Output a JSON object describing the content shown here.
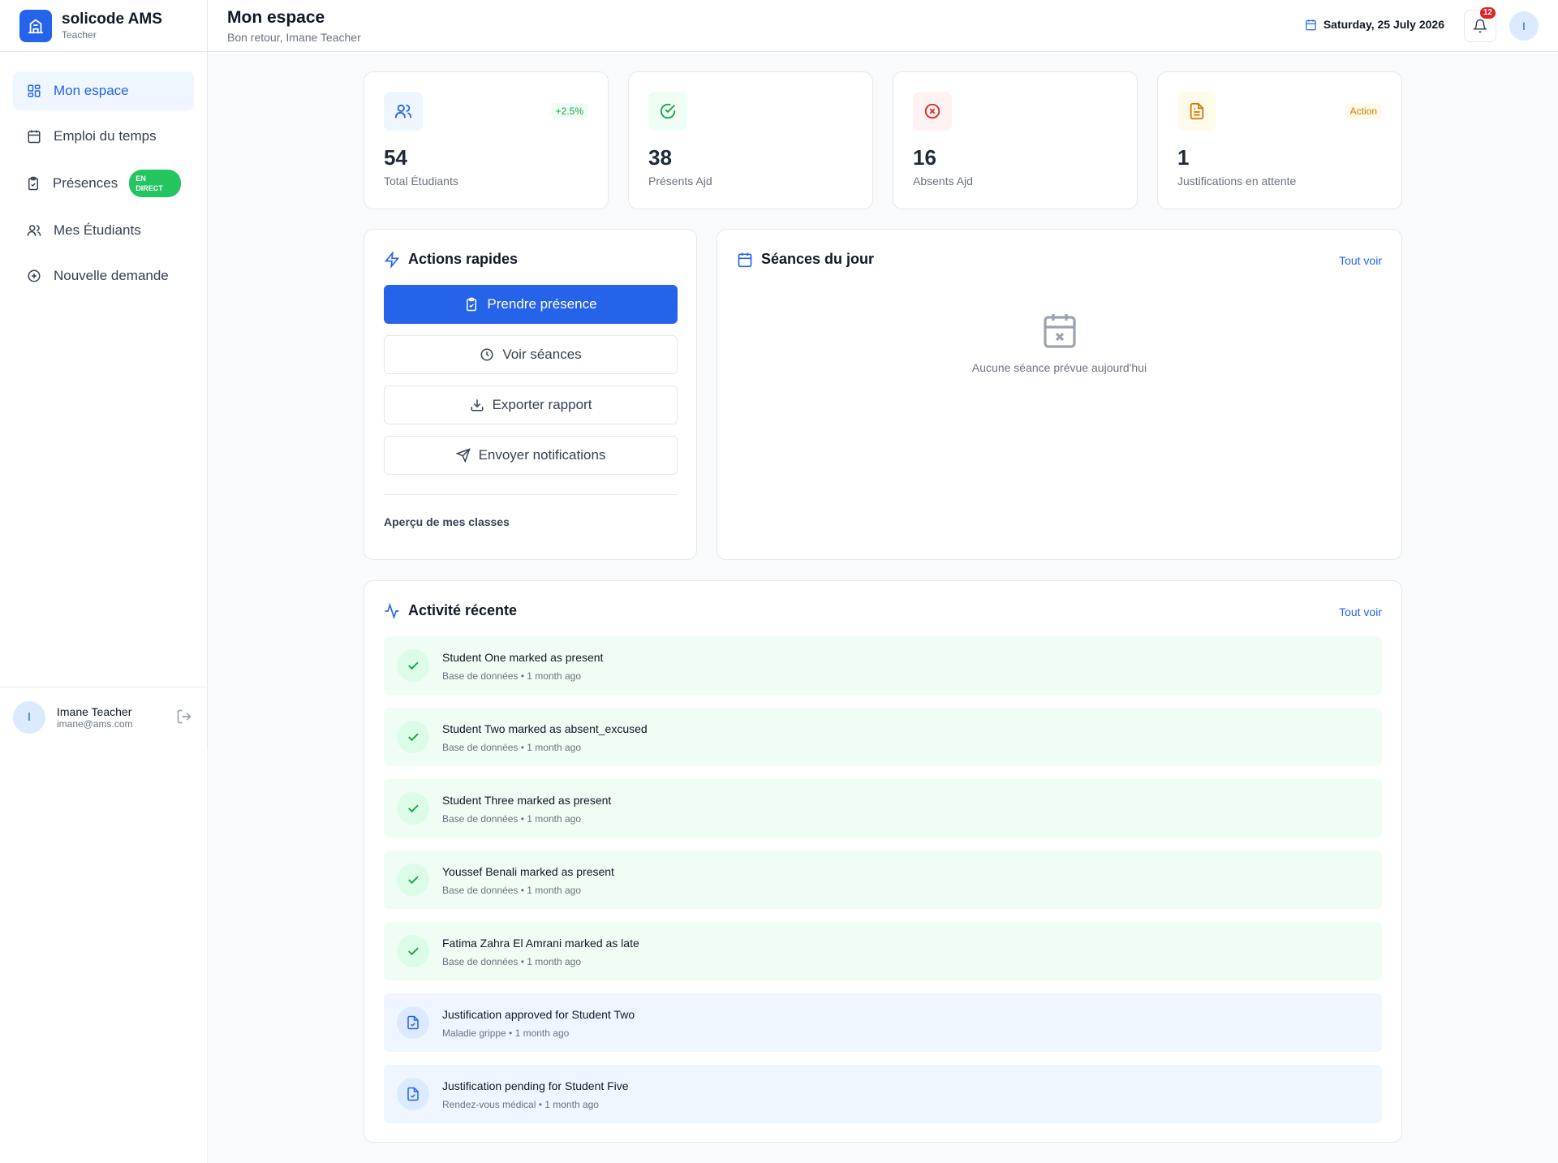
{
  "app": {
    "name": "solicode AMS",
    "role": "Teacher",
    "brand_color": "#2563eb"
  },
  "sidebar": {
    "items": [
      {
        "label": "Mon espace",
        "icon": "dashboard-grid-icon",
        "active": true
      },
      {
        "label": "Emploi du temps",
        "icon": "calendar-icon"
      },
      {
        "label": "Présences",
        "icon": "clipboard-check-icon",
        "badge": "EN DIRECT"
      },
      {
        "label": "Mes Étudiants",
        "icon": "users-icon"
      },
      {
        "label": "Nouvelle demande",
        "icon": "plus-circle-icon"
      }
    ],
    "user": {
      "initial": "I",
      "name": "Imane Teacher",
      "email": "imane@ams.com"
    }
  },
  "header": {
    "title": "Mon espace",
    "subtitle": "Bon retour, Imane Teacher",
    "date": "Saturday, 25 July 2026",
    "notifications": "12",
    "avatar_initial": "I"
  },
  "stats": [
    {
      "value": "54",
      "label": "Total Étudiants",
      "tag": "+2.5%",
      "icon": "users-icon",
      "color": "#2563eb"
    },
    {
      "value": "38",
      "label": "Présents Ajd",
      "icon": "check-circle-icon",
      "color": "#16a34a"
    },
    {
      "value": "16",
      "label": "Absents Ajd",
      "icon": "x-circle-icon",
      "color": "#dc2626"
    },
    {
      "value": "1",
      "label": "Justifications en attente",
      "tag": "Action",
      "icon": "file-text-icon",
      "color": "#d97706"
    }
  ],
  "quick_actions": {
    "title": "Actions rapides",
    "buttons": [
      {
        "label": "Prendre présence",
        "icon": "clipboard-icon"
      },
      {
        "label": "Voir séances",
        "icon": "clock-icon"
      },
      {
        "label": "Exporter rapport",
        "icon": "download-icon"
      },
      {
        "label": "Envoyer notifications",
        "icon": "send-icon"
      }
    ],
    "classes_overview": "Aperçu de mes classes"
  },
  "sessions": {
    "title": "Séances du jour",
    "see_all": "Tout voir",
    "empty": "Aucune séance prévue aujourd'hui"
  },
  "activity": {
    "title": "Activité récente",
    "see_all": "Tout voir",
    "items": [
      {
        "title": "Student One marked as present",
        "meta": "Base de données • 1 month ago",
        "kind": "attendance"
      },
      {
        "title": "Student Two marked as absent_excused",
        "meta": "Base de données • 1 month ago",
        "kind": "attendance"
      },
      {
        "title": "Student Three marked as present",
        "meta": "Base de données • 1 month ago",
        "kind": "attendance"
      },
      {
        "title": "Youssef Benali marked as present",
        "meta": "Base de données • 1 month ago",
        "kind": "attendance"
      },
      {
        "title": "Fatima Zahra El Amrani marked as late",
        "meta": "Base de données • 1 month ago",
        "kind": "attendance"
      },
      {
        "title": "Justification approved for Student Two",
        "meta": "Maladie grippe • 1 month ago",
        "kind": "justification"
      },
      {
        "title": "Justification pending for Student Five",
        "meta": "Rendez-vous médical • 1 month ago",
        "kind": "justification"
      }
    ]
  }
}
